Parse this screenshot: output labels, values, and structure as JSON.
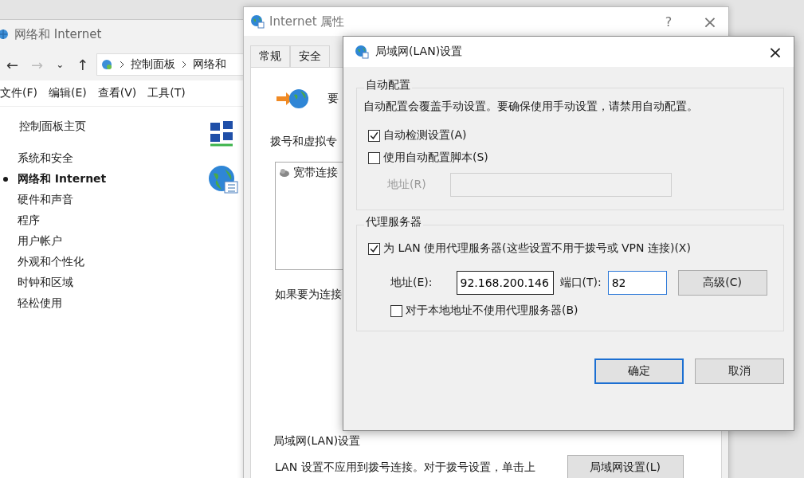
{
  "control_panel": {
    "title": "网络和 Internet",
    "nav": {
      "back": "←",
      "forward": "→",
      "recent": "⌄",
      "up": "↑"
    },
    "breadcrumb": [
      "控制面板",
      "网络和"
    ],
    "menu": [
      "文件(F)",
      "编辑(E)",
      "查看(V)",
      "工具(T)"
    ],
    "sidebar": {
      "home": "控制面板主页",
      "items": [
        {
          "label": "系统和安全",
          "selected": false
        },
        {
          "label": "网络和 Internet",
          "selected": true
        },
        {
          "label": "硬件和声音",
          "selected": false
        },
        {
          "label": "程序",
          "selected": false
        },
        {
          "label": "用户帐户",
          "selected": false
        },
        {
          "label": "外观和个性化",
          "selected": false
        },
        {
          "label": "时钟和区域",
          "selected": false
        },
        {
          "label": "轻松使用",
          "selected": false
        }
      ]
    }
  },
  "internet_properties": {
    "title": "Internet 属性",
    "help": "?",
    "close": "×",
    "tabs": [
      {
        "label": "常规",
        "selected": false
      },
      {
        "label": "安全",
        "selected": false
      }
    ],
    "setup_text": "要",
    "dialup_label": "拨号和虚拟专",
    "connections": [
      "宽带连接"
    ],
    "connection_hint": "如果要为连接",
    "lan_heading": "局域网(LAN)设置",
    "lan_note": "LAN 设置不应用到拨号连接。对于拨号设置，单击上",
    "lan_button": "局域网设置(L)"
  },
  "lan_dialog": {
    "title": "局域网(LAN)设置",
    "close": "×",
    "auto_config": {
      "heading": "自动配置",
      "description": "自动配置会覆盖手动设置。要确保使用手动设置，请禁用自动配置。",
      "options": [
        {
          "label": "自动检测设置(A)",
          "checked": true
        },
        {
          "label": "使用自动配置脚本(S)",
          "checked": false
        }
      ],
      "address": {
        "label": "地址(R)",
        "disabled": true
      }
    },
    "proxy": {
      "heading": "代理服务器",
      "use_proxy": {
        "label": "为 LAN 使用代理服务器(这些设置不用于拨号或 VPN 连接)(X)",
        "checked": true
      },
      "address": {
        "label": "地址(E):",
        "value": "92.168.200.146"
      },
      "port": {
        "label": "端口(T):",
        "value": "82",
        "focused": true
      },
      "advanced": "高级(C)",
      "bypass_local": {
        "label": "对于本地地址不使用代理服务器(B)",
        "checked": false
      }
    },
    "buttons": [
      {
        "label": "确定",
        "default": true
      },
      {
        "label": "取消",
        "default": false
      }
    ]
  }
}
